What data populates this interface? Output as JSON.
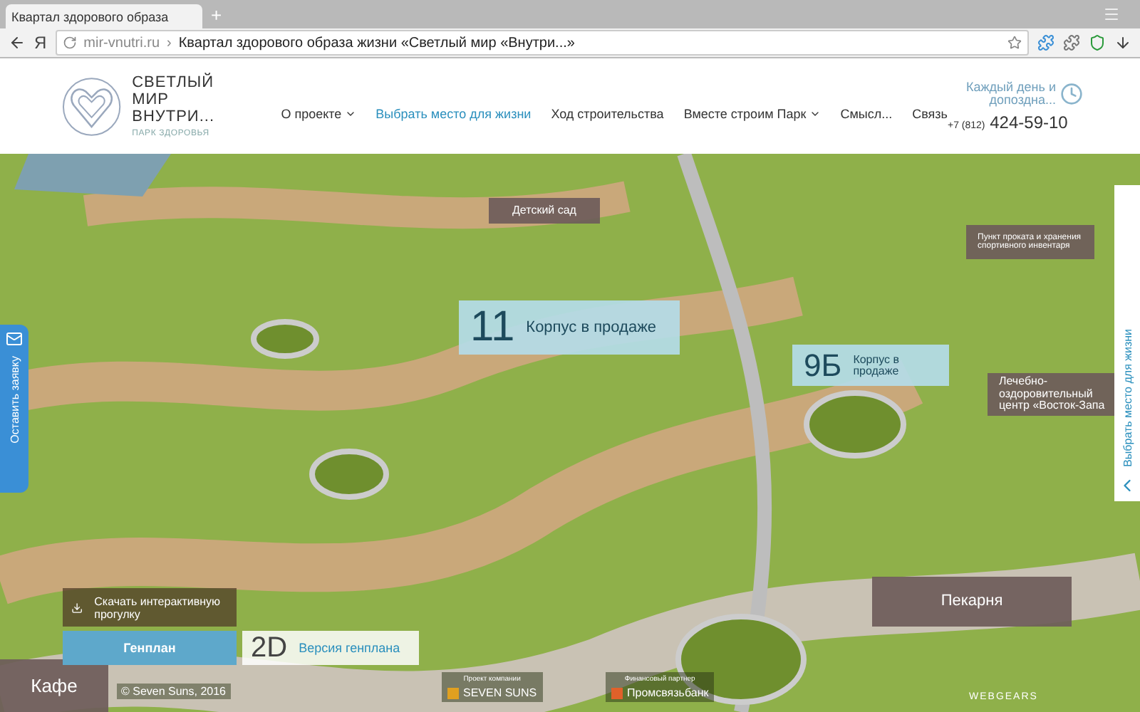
{
  "browser": {
    "tab_title": "Квартал здорового образа",
    "new_tab": "+",
    "yandex": "Я",
    "url_domain": "mir-vnutri.ru",
    "url_separator": "›",
    "page_title": "Квартал здорового образа жизни «Светлый мир «Внутри...»"
  },
  "header": {
    "logo_title": "СВЕТЛЫЙ МИР ВНУТРИ...",
    "logo_subtitle": "ПАРК ЗДОРОВЬЯ",
    "hours": "Каждый день и допоздна...",
    "phone_prefix": "+7 (812)",
    "phone": "424-59-10",
    "nav": [
      {
        "label": "О проекте",
        "selected": false,
        "dropdown": true
      },
      {
        "label": "Выбрать место для жизни",
        "selected": true,
        "dropdown": false
      },
      {
        "label": "Ход строительства",
        "selected": false,
        "dropdown": false
      },
      {
        "label": "Вместе строим Парк",
        "selected": false,
        "dropdown": true
      },
      {
        "label": "Смысл...",
        "selected": false,
        "dropdown": false
      },
      {
        "label": "Связь",
        "selected": false,
        "dropdown": false
      }
    ]
  },
  "map": {
    "labels": [
      {
        "kind": "venue",
        "text": "Детский сад"
      },
      {
        "kind": "venue",
        "text": "Пункт проката и хранения спортивного инвентаря"
      },
      {
        "kind": "sale",
        "number": "11",
        "text": "Корпус в продаже"
      },
      {
        "kind": "sale",
        "number": "9Б",
        "text": "Корпус в продаже"
      },
      {
        "kind": "venue",
        "text": "Лечебно-оздоровительный центр «Восток-Запа"
      },
      {
        "kind": "venue",
        "text": "Пекарня"
      },
      {
        "kind": "venue",
        "text": "Кафе"
      }
    ]
  },
  "request_tab": "Оставить заявку",
  "place_tab": "Выбрать место для жизни",
  "footer": {
    "download": "Скачать интерактивную прогулку",
    "plan_button": "Генплан",
    "plan_2d_badge": "2D",
    "plan_2d_label": "Версия генплана",
    "copyright": "© Seven Suns, 2016",
    "partners": [
      {
        "caption": "Проект компании",
        "name": "SEVEN SUNS"
      },
      {
        "caption": "Финансовый партнер",
        "name": "Промсвязьбанк"
      }
    ],
    "developer": "WEBGEARS"
  }
}
